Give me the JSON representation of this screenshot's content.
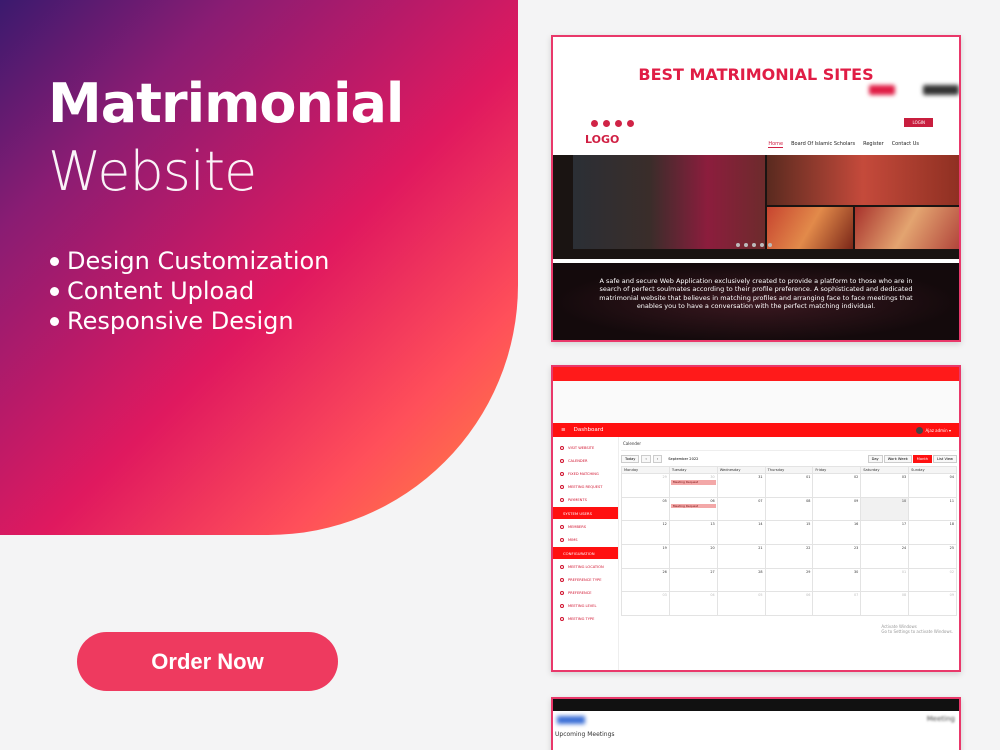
{
  "hero": {
    "title": "Matrimonial",
    "subtitle": "Website",
    "features": [
      "Design Customization",
      "Content Upload",
      "Responsive Design"
    ],
    "cta": "Order Now",
    "colors": {
      "cta": "#ee3a5f",
      "accent": "#e01d45"
    }
  },
  "card1": {
    "banner": "BEST MATRIMONIAL SITES",
    "login": "LOGIN",
    "logo": "LOGO",
    "menu": [
      "Home",
      "Board Of Islamic Scholars",
      "Register",
      "Contact Us"
    ],
    "about": "A safe and secure Web Application exclusively created to provide a platform to those who are in search of perfect soulmates according to their profile preference. A sophisticated and dedicated matrimonial website that believes in matching profiles and arranging face to face meetings that enables you to have a conversation with the perfect matching individual."
  },
  "card2": {
    "header": "Dashboard",
    "user": "Ajaz admin ▾",
    "sidebar": {
      "group1": [
        "VISIT WEBSITE",
        "CALENDER",
        "FIXED MATCHING",
        "MEETING REQUEST",
        "PAYMENTS"
      ],
      "section1": "SYSTEM USERS",
      "group2": [
        "MEMBERS",
        "MIMS"
      ],
      "section2": "CONFIGURATION",
      "group3": [
        "MEETING LOCATION",
        "PREFERENCE TYPE",
        "PREFERENCE",
        "MEETING LEVEL",
        "MEETING TYPE"
      ]
    },
    "calendar": {
      "title": "Calender",
      "today": "Today",
      "prev": "‹",
      "next": "›",
      "month": "September 2022",
      "views": [
        "Day",
        "Work Week",
        "Month",
        "List View"
      ],
      "days": [
        "Monday",
        "Tuesday",
        "Wednesday",
        "Thursday",
        "Friday",
        "Saturday",
        "Sunday"
      ],
      "weeks": [
        [
          "29",
          "30",
          "31",
          "01",
          "02",
          "03",
          "04"
        ],
        [
          "05",
          "06",
          "07",
          "08",
          "09",
          "10",
          "11"
        ],
        [
          "12",
          "13",
          "14",
          "15",
          "16",
          "17",
          "18"
        ],
        [
          "19",
          "20",
          "21",
          "22",
          "23",
          "24",
          "25"
        ],
        [
          "26",
          "27",
          "28",
          "29",
          "30",
          "01",
          "02"
        ],
        [
          "03",
          "04",
          "05",
          "06",
          "07",
          "08",
          "09"
        ]
      ],
      "event_label": "Meeting Request"
    },
    "watermark": [
      "Activate Windows",
      "Go to Settings to activate Windows."
    ]
  },
  "card3": {
    "label": "Upcoming Meetings",
    "right_text": "Meeting"
  }
}
